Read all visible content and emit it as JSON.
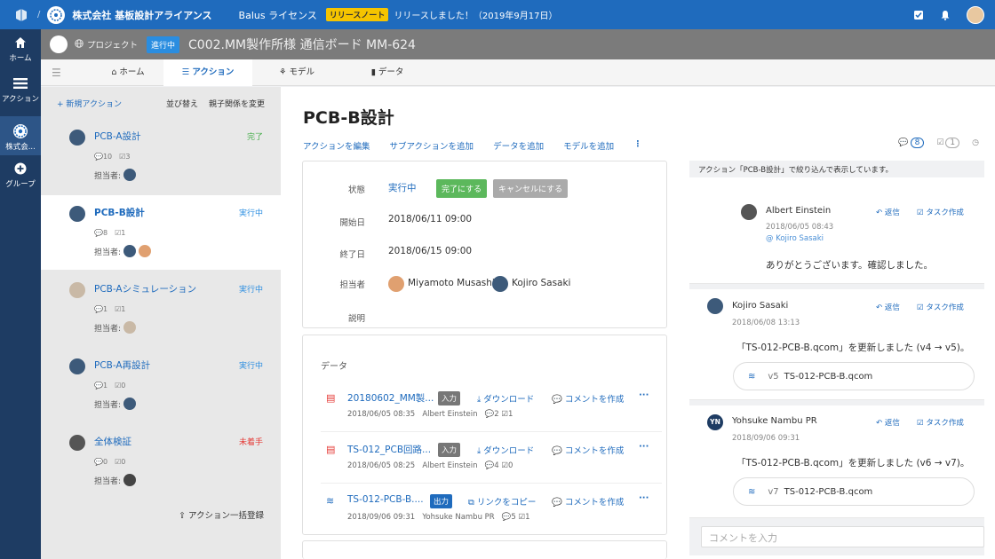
{
  "topbar": {
    "org": "株式会社 基板設計アライアンス",
    "license": "Balus ライセンス",
    "release_badge": "リリースノート",
    "announcement": "リリースしました！（2019年9月17日）"
  },
  "leftnav": {
    "items": [
      {
        "label": "ホーム"
      },
      {
        "label": "アクション"
      },
      {
        "label": "株式会..."
      },
      {
        "label": "グループ"
      }
    ]
  },
  "project": {
    "crumb": "プロジェクト",
    "status": "進行中",
    "title": "C002.MM製作所様 通信ボード MM-624"
  },
  "tabs": [
    {
      "label": "ホーム"
    },
    {
      "label": "アクション"
    },
    {
      "label": "モデル"
    },
    {
      "label": "データ"
    }
  ],
  "action_list": {
    "new": "新規アクション",
    "sort": "並び替え",
    "relation": "親子関係を変更",
    "bulk": "アクション一括登録",
    "assignee_label": "担当者:",
    "items": [
      {
        "name": "PCB-A設計",
        "status": "完了",
        "status_color": "#4caf50",
        "c1": "10",
        "c2": "3"
      },
      {
        "name": "PCB-B設計",
        "status": "実行中",
        "status_color": "#2a8de0",
        "c1": "8",
        "c2": "1"
      },
      {
        "name": "PCB-Aシミュレーション",
        "status": "実行中",
        "status_color": "#2a8de0",
        "c1": "1",
        "c2": "1"
      },
      {
        "name": "PCB-A再設計",
        "status": "実行中",
        "status_color": "#2a8de0",
        "c1": "1",
        "c2": "0"
      },
      {
        "name": "全体検証",
        "status": "未着手",
        "status_color": "#e53935",
        "c1": "0",
        "c2": "0"
      }
    ]
  },
  "detail": {
    "title": "PCB-B設計",
    "tools": [
      "アクションを編集",
      "サブアクションを追加",
      "データを追加",
      "モデルを追加"
    ],
    "comment_count": "8",
    "task_count": "1",
    "state_label": "状態",
    "state": "実行中",
    "complete_btn": "完了にする",
    "cancel_btn": "キャンセルにする",
    "start_label": "開始日",
    "start": "2018/06/11 09:00",
    "end_label": "終了日",
    "end": "2018/06/15 09:00",
    "assignee_label": "担当者",
    "assignee1": "Miyamoto Musashi",
    "assignee2": "Kojiro Sasaki",
    "desc_label": "説明"
  },
  "data_section": {
    "title": "データ",
    "rows": [
      {
        "name": "20180602_MM製...",
        "tag": "入力",
        "action": "ダウンロード",
        "comment": "コメントを作成",
        "date": "2018/06/05 08:35",
        "user": "Albert Einstein",
        "c1": "2",
        "c2": "1"
      },
      {
        "name": "TS-012_PCB回路...",
        "tag": "入力",
        "action": "ダウンロード",
        "comment": "コメントを作成",
        "date": "2018/06/05 08:25",
        "user": "Albert Einstein",
        "c1": "4",
        "c2": "0"
      },
      {
        "name": "TS-012-PCB-B....",
        "tag": "出力",
        "action": "リンクをコピー",
        "comment": "コメントを作成",
        "date": "2018/09/06 09:31",
        "user": "Yohsuke Nambu PR",
        "c1": "5",
        "c2": "1"
      }
    ]
  },
  "comments": {
    "filter_note": "アクション「PCB-B設計」で絞り込んで表示しています。",
    "reply": "返信",
    "task": "タスク作成",
    "input_placeholder": "コメントを入力",
    "items": [
      {
        "author": "Albert Einstein",
        "time": "2018/06/05 08:43",
        "to": "@ Kojiro Sasaki",
        "body": "ありがとうございます。確認しました。"
      },
      {
        "author": "Kojiro Sasaki",
        "time": "2018/06/08 13:13",
        "body": "「TS-012-PCB-B.qcom」を更新しました (v4 → v5)。",
        "file_ver": "v5",
        "file_name": "TS-012-PCB-B.qcom"
      },
      {
        "author": "Yohsuke Nambu PR",
        "initials": "YN",
        "time": "2018/09/06 09:31",
        "body": "「TS-012-PCB-B.qcom」を更新しました (v6 → v7)。",
        "file_ver": "v7",
        "file_name": "TS-012-PCB-B.qcom"
      }
    ]
  }
}
